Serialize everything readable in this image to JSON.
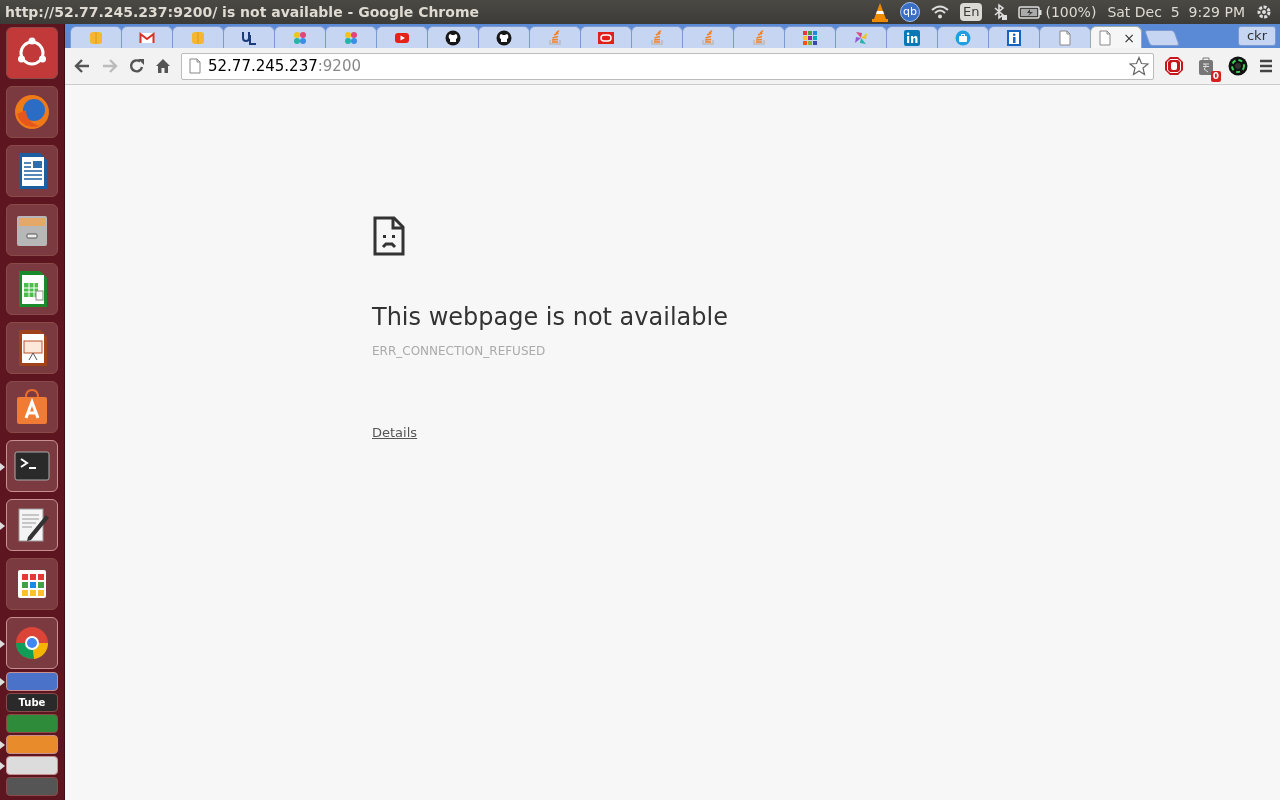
{
  "window": {
    "title": "http://52.77.245.237:9200/ is not available - Google Chrome"
  },
  "panel": {
    "tray": [
      {
        "kind": "vlc"
      },
      {
        "kind": "qb",
        "text": "qb"
      },
      {
        "kind": "wifi"
      },
      {
        "kind": "keyboard",
        "text": "En"
      },
      {
        "kind": "bluetooth"
      },
      {
        "kind": "battery",
        "text": "(100%)"
      },
      {
        "kind": "clock",
        "text": "Sat Dec  5  9:29 PM"
      },
      {
        "kind": "power"
      }
    ]
  },
  "launcher": [
    {
      "kind": "dash",
      "running": false,
      "folded": false
    },
    {
      "kind": "firefox",
      "running": false,
      "folded": false
    },
    {
      "kind": "writer",
      "running": false,
      "folded": false
    },
    {
      "kind": "files",
      "running": false,
      "folded": false
    },
    {
      "kind": "calc",
      "running": false,
      "folded": false
    },
    {
      "kind": "impress",
      "running": false,
      "folded": false
    },
    {
      "kind": "store",
      "running": false,
      "folded": false
    },
    {
      "kind": "terminal",
      "running": true,
      "folded": false
    },
    {
      "kind": "editor",
      "running": true,
      "folded": false
    },
    {
      "kind": "apps",
      "running": false,
      "folded": false
    },
    {
      "kind": "chrome",
      "running": true,
      "folded": false
    },
    {
      "kind": "qbit",
      "running": true,
      "folded": true
    },
    {
      "kind": "tube",
      "running": false,
      "folded": true,
      "text": "Tube"
    },
    {
      "kind": "sync",
      "running": false,
      "folded": true
    },
    {
      "kind": "updater",
      "running": true,
      "folded": true
    },
    {
      "kind": "vlcstack",
      "running": true,
      "folded": true
    },
    {
      "kind": "drive",
      "running": false,
      "folded": true
    }
  ],
  "tabs": [
    {
      "kind": "box",
      "selected": false
    },
    {
      "kind": "gmail",
      "selected": false
    },
    {
      "kind": "box",
      "selected": false
    },
    {
      "kind": "ul",
      "selected": false
    },
    {
      "kind": "dots",
      "selected": false
    },
    {
      "kind": "dots",
      "selected": false
    },
    {
      "kind": "youtube",
      "selected": false
    },
    {
      "kind": "github",
      "selected": false
    },
    {
      "kind": "github",
      "selected": false
    },
    {
      "kind": "stack",
      "selected": false
    },
    {
      "kind": "oracle",
      "selected": false
    },
    {
      "kind": "stack",
      "selected": false
    },
    {
      "kind": "stack",
      "selected": false
    },
    {
      "kind": "stack",
      "selected": false
    },
    {
      "kind": "grid",
      "selected": false
    },
    {
      "kind": "pinwheel",
      "selected": false
    },
    {
      "kind": "linkedin",
      "selected": false
    },
    {
      "kind": "briefcase",
      "selected": false
    },
    {
      "kind": "info",
      "selected": false
    },
    {
      "kind": "page",
      "selected": false
    },
    {
      "kind": "page",
      "selected": true,
      "close": "×"
    }
  ],
  "profile": "ckr",
  "omnibox": {
    "host": "52.77.245.237",
    "port": ":9200"
  },
  "extensions": [
    {
      "kind": "stop"
    },
    {
      "kind": "rupee",
      "badge": "0"
    },
    {
      "kind": "lens"
    }
  ],
  "page": {
    "title": "This webpage is not available",
    "error_code": "ERR_CONNECTION_REFUSED",
    "details_link": "Details"
  }
}
